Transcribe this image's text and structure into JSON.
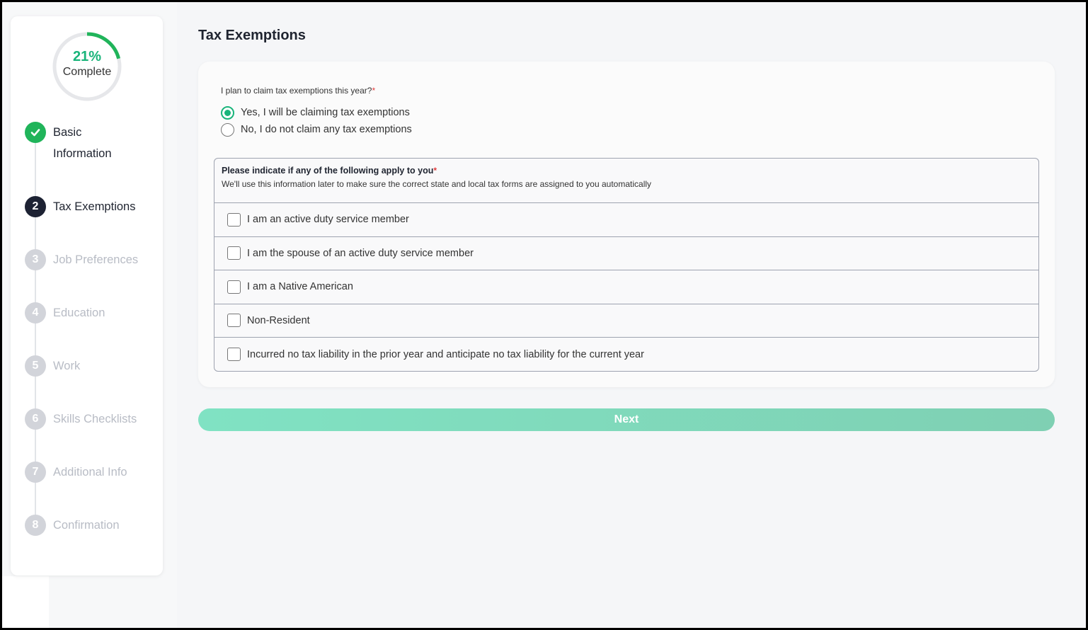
{
  "progress": {
    "percent_label": "21%",
    "label": "Complete",
    "fraction": 0.21
  },
  "steps": [
    {
      "number": "",
      "label": "Basic Information",
      "state": "done"
    },
    {
      "number": "2",
      "label": "Tax Exemptions",
      "state": "active"
    },
    {
      "number": "3",
      "label": "Job Preferences",
      "state": "todo"
    },
    {
      "number": "4",
      "label": "Education",
      "state": "todo"
    },
    {
      "number": "5",
      "label": "Work",
      "state": "todo"
    },
    {
      "number": "6",
      "label": "Skills Checklists",
      "state": "todo"
    },
    {
      "number": "7",
      "label": "Additional Info",
      "state": "todo"
    },
    {
      "number": "8",
      "label": "Confirmation",
      "state": "todo"
    }
  ],
  "page": {
    "title": "Tax Exemptions"
  },
  "claim": {
    "question": "I plan to claim tax exemptions this year?",
    "required_mark": "*",
    "options": [
      {
        "label": "Yes, I will be claiming tax exemptions",
        "checked": true
      },
      {
        "label": "No, I do not claim any tax exemptions",
        "checked": false
      }
    ]
  },
  "apply": {
    "title": "Please indicate if any of the following apply to you",
    "required_mark": "*",
    "subtitle": "We'll use this information later to make sure the correct state and local tax forms are assigned to you automatically",
    "options": [
      "I am an active duty service member",
      "I am the spouse of an active duty service member",
      "I am a Native American",
      "Non-Resident",
      "Incurred no tax liability in the prior year and anticipate no tax liability for the current year"
    ]
  },
  "next_label": "Next",
  "colors": {
    "accent": "#19b47a",
    "done": "#20b45a",
    "active": "#1d2233",
    "todo": "#d2d4da"
  }
}
